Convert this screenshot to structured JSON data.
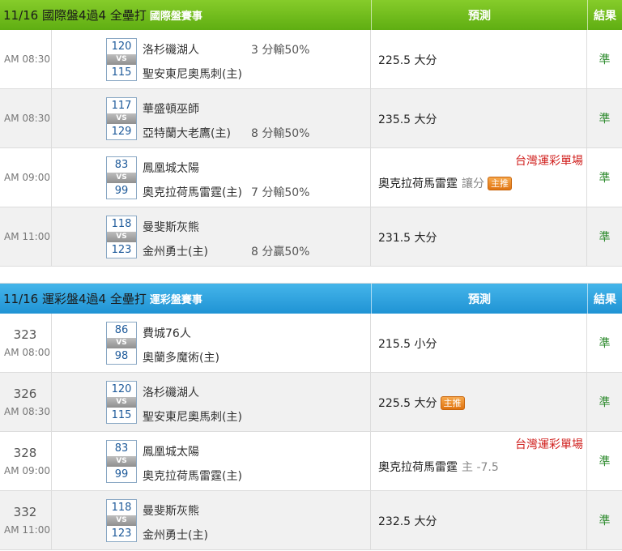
{
  "section1": {
    "title": "11/16 國際盤4過4 全壘打",
    "tag": "國際盤賽事",
    "pred_header": "預測",
    "res_header": "結果",
    "rows": [
      {
        "num": "",
        "time": "AM 08:30",
        "score1": "120",
        "score2": "115",
        "team1": "洛杉磯湖人",
        "team2": "聖安東尼奧馬刺(主)",
        "odds1": "3 分輸50%",
        "odds2": "",
        "single": "",
        "prediction": "225.5 大分",
        "extra": "",
        "badge": "",
        "result": "準"
      },
      {
        "num": "",
        "time": "AM 08:30",
        "score1": "117",
        "score2": "129",
        "team1": "華盛頓巫師",
        "team2": "亞特蘭大老鷹(主)",
        "odds1": "",
        "odds2": "8 分輸50%",
        "single": "",
        "prediction": "235.5 大分",
        "extra": "",
        "badge": "",
        "result": "準"
      },
      {
        "num": "",
        "time": "AM 09:00",
        "score1": "83",
        "score2": "99",
        "team1": "鳳凰城太陽",
        "team2": "奧克拉荷馬雷霆(主)",
        "odds1": "",
        "odds2": "7 分輸50%",
        "single": "台灣運彩單場",
        "prediction": "奧克拉荷馬雷霆",
        "extra": "讓分",
        "badge": "主推",
        "result": "準"
      },
      {
        "num": "",
        "time": "AM 11:00",
        "score1": "118",
        "score2": "123",
        "team1": "曼斐斯灰熊",
        "team2": "金州勇士(主)",
        "odds1": "",
        "odds2": "8 分贏50%",
        "single": "",
        "prediction": "231.5 大分",
        "extra": "",
        "badge": "",
        "result": "準"
      }
    ]
  },
  "section2": {
    "title": "11/16 運彩盤4過4 全壘打",
    "tag": "運彩盤賽事",
    "pred_header": "預測",
    "res_header": "結果",
    "rows": [
      {
        "num": "323",
        "time": "AM 08:00",
        "score1": "86",
        "score2": "98",
        "team1": "費城76人",
        "team2": "奧蘭多魔術(主)",
        "odds1": "",
        "odds2": "",
        "single": "",
        "prediction": "215.5 小分",
        "extra": "",
        "badge": "",
        "result": "準"
      },
      {
        "num": "326",
        "time": "AM 08:30",
        "score1": "120",
        "score2": "115",
        "team1": "洛杉磯湖人",
        "team2": "聖安東尼奧馬刺(主)",
        "odds1": "",
        "odds2": "",
        "single": "",
        "prediction": "225.5 大分",
        "extra": "",
        "badge": "主推",
        "result": "準"
      },
      {
        "num": "328",
        "time": "AM 09:00",
        "score1": "83",
        "score2": "99",
        "team1": "鳳凰城太陽",
        "team2": "奧克拉荷馬雷霆(主)",
        "odds1": "",
        "odds2": "",
        "single": "台灣運彩單場",
        "prediction": "奧克拉荷馬雷霆",
        "extra": "主 -7.5",
        "badge": "",
        "result": "準"
      },
      {
        "num": "332",
        "time": "AM 11:00",
        "score1": "118",
        "score2": "123",
        "team1": "曼斐斯灰熊",
        "team2": "金州勇士(主)",
        "odds1": "",
        "odds2": "",
        "single": "",
        "prediction": "232.5 大分",
        "extra": "",
        "badge": "",
        "result": "準"
      }
    ]
  },
  "vs_label": "VS"
}
